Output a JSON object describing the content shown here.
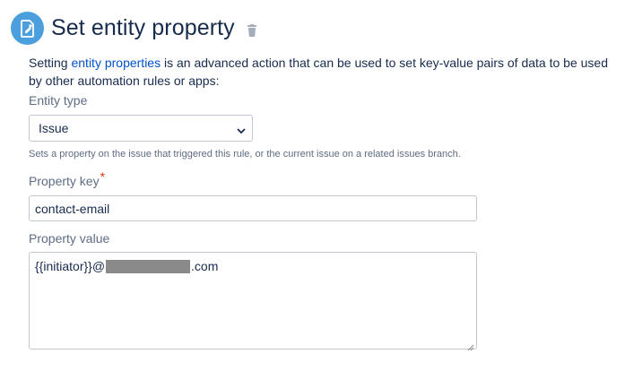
{
  "header": {
    "title": "Set entity property",
    "icon": "edit-property-icon",
    "delete_icon": "trash-icon"
  },
  "description": {
    "prefix": "Setting ",
    "link_text": "entity properties",
    "suffix": " is an advanced action that can be used to set key-value pairs of data to be used by other automation rules or apps:"
  },
  "entity_type": {
    "label": "Entity type",
    "selected": "Issue",
    "help": "Sets a property on the issue that triggered this rule, or the current issue on a related issues branch."
  },
  "property_key": {
    "label": "Property key",
    "required_marker": "*",
    "value": "contact-email"
  },
  "property_value": {
    "label": "Property value",
    "value_prefix": "{{initiator}}@",
    "value_suffix": ".com"
  },
  "colors": {
    "accent": "#4a9fdc",
    "link": "#0052cc",
    "required": "#de350b"
  }
}
